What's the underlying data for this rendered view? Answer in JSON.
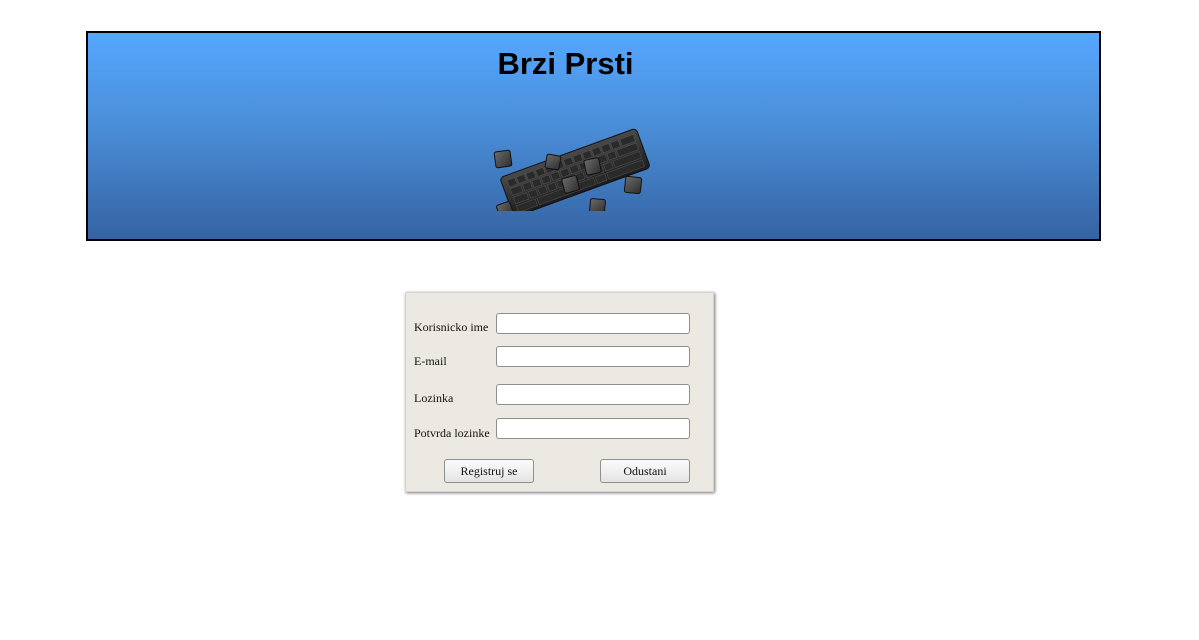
{
  "header": {
    "title": "Brzi Prsti",
    "logo_icon": "keyboard-icon",
    "gradient_top": "#56a7ff",
    "gradient_bottom": "#3563a3"
  },
  "form": {
    "fields": [
      {
        "label": "Korisnicko ime",
        "value": "",
        "placeholder": ""
      },
      {
        "label": "E-mail",
        "value": "",
        "placeholder": ""
      },
      {
        "label": "Lozinka",
        "value": "",
        "placeholder": ""
      },
      {
        "label": "Potvrda lozinke",
        "value": "",
        "placeholder": ""
      }
    ],
    "register_label": "Registruj se",
    "cancel_label": "Odustani",
    "panel_color": "#ece9e2"
  }
}
